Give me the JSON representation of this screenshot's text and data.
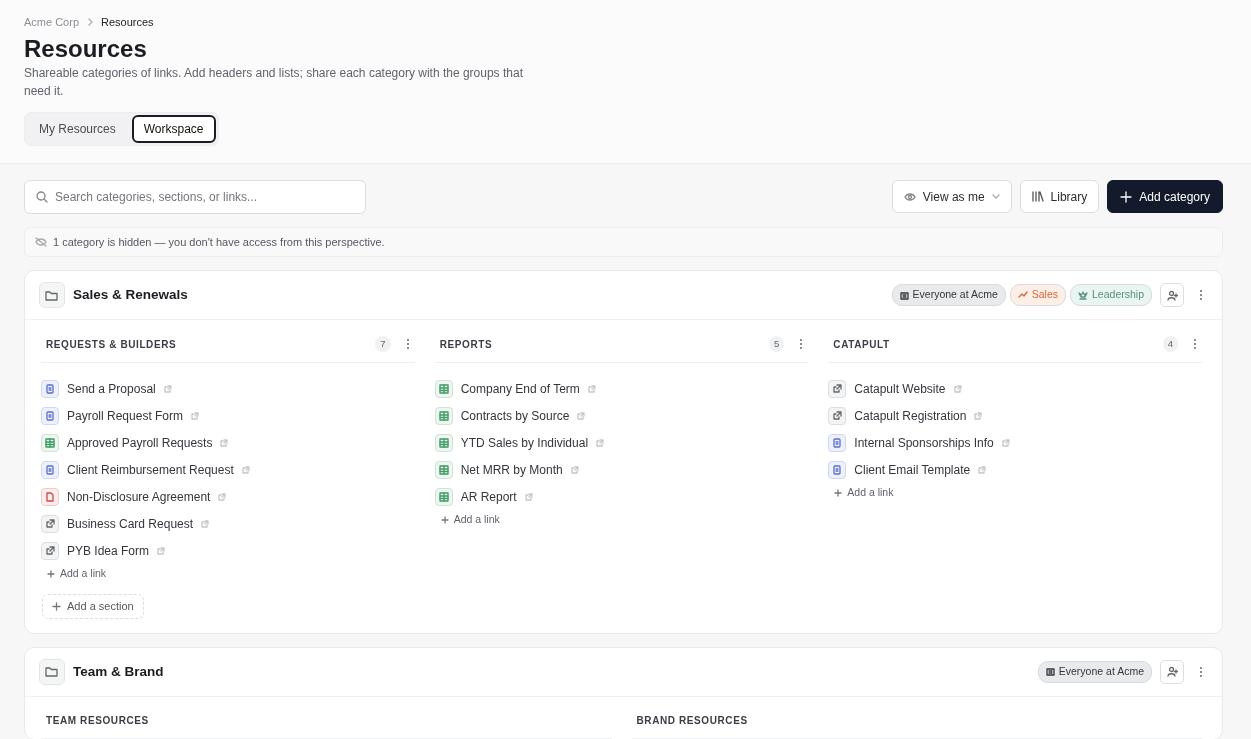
{
  "breadcrumb": [
    "Acme Corp",
    "Resources"
  ],
  "title": "Resources",
  "description": "Shareable categories of links. Add headers and lists; share each category with the groups that need it.",
  "tabs": [
    {
      "label": "My Resources",
      "selected": false
    },
    {
      "label": "Workspace",
      "selected": true
    }
  ],
  "toolbar": {
    "search_placeholder": "Search categories, sections, or links...",
    "view_as": "View as me",
    "library": "Library",
    "add_category": "Add category"
  },
  "notice": "1 category is hidden — you don't have access from this perspective.",
  "categories": [
    {
      "title": "Sales & Renewals",
      "tags": [
        {
          "label": "Everyone at Acme",
          "kind": "everyone",
          "color": "#e9eaec"
        },
        {
          "label": "Sales",
          "kind": "sales",
          "color": "#fdeee6"
        },
        {
          "label": "Leadership",
          "kind": "leadership",
          "color": "#e8f5f1"
        }
      ],
      "sections": [
        {
          "title": "REQUESTS & BUILDERS",
          "count": "7",
          "add_link": "Add a link",
          "links": [
            {
              "title": "Send a Proposal",
              "kind": "doc"
            },
            {
              "title": "Payroll Request Form",
              "kind": "doc"
            },
            {
              "title": "Approved Payroll Requests",
              "kind": "sheet"
            },
            {
              "title": "Client Reimbursement Request",
              "kind": "doc"
            },
            {
              "title": "Non-Disclosure Agreement",
              "kind": "pdf"
            },
            {
              "title": "Business Card Request",
              "kind": "web"
            },
            {
              "title": "PYB Idea Form",
              "kind": "web"
            }
          ]
        },
        {
          "title": "REPORTS",
          "count": "5",
          "add_link": "Add a link",
          "links": [
            {
              "title": "Company End of Term",
              "kind": "sheet"
            },
            {
              "title": "Contracts by Source",
              "kind": "sheet"
            },
            {
              "title": "YTD Sales by Individual",
              "kind": "sheet"
            },
            {
              "title": "Net MRR by Month",
              "kind": "sheet"
            },
            {
              "title": "AR Report",
              "kind": "sheet"
            }
          ]
        },
        {
          "title": "CATAPULT",
          "count": "4",
          "add_link": "Add a link",
          "links": [
            {
              "title": "Catapult Website",
              "kind": "web"
            },
            {
              "title": "Catapult Registration",
              "kind": "web"
            },
            {
              "title": "Internal Sponsorships Info",
              "kind": "doc"
            },
            {
              "title": "Client Email Template",
              "kind": "doc"
            }
          ]
        }
      ],
      "add_section": "Add a section"
    },
    {
      "title": "Team & Brand",
      "tags": [
        {
          "label": "Everyone at Acme",
          "kind": "everyone",
          "color": "#e9eaec"
        }
      ],
      "sections": [
        {
          "title": "TEAM RESOURCES"
        },
        {
          "title": "BRAND RESOURCES"
        }
      ]
    }
  ]
}
